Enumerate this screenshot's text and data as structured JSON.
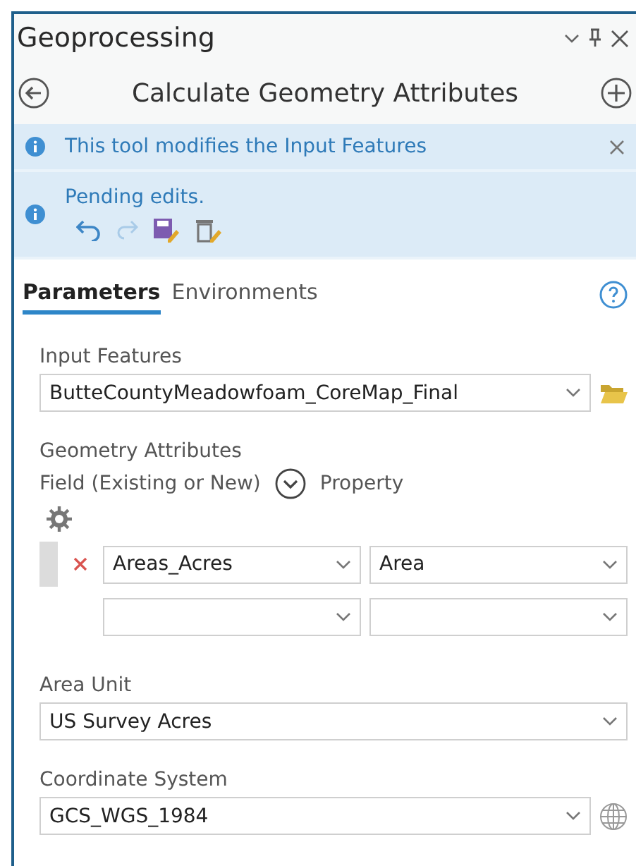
{
  "pane": {
    "title": "Geoprocessing"
  },
  "tool": {
    "title": "Calculate Geometry Attributes"
  },
  "messages": [
    {
      "text": "This tool modifies the Input Features",
      "dismissable": true,
      "edit_tools": false
    },
    {
      "text": "Pending edits.",
      "dismissable": false,
      "edit_tools": true
    }
  ],
  "tabs": [
    {
      "label": "Parameters",
      "selected": true
    },
    {
      "label": "Environments",
      "selected": false
    }
  ],
  "input_features": {
    "label": "Input Features",
    "value": "ButteCountyMeadowfoam_CoreMap_Final"
  },
  "geometry_attributes": {
    "label": "Geometry Attributes",
    "field_header": "Field (Existing or New)",
    "property_header": "Property",
    "rows": [
      {
        "field": "Areas_Acres",
        "property": "Area"
      },
      {}
    ]
  },
  "area_unit": {
    "label": "Area Unit",
    "value": "US Survey Acres"
  },
  "coordinate_system": {
    "label": "Coordinate System",
    "value": "GCS_WGS_1984"
  }
}
